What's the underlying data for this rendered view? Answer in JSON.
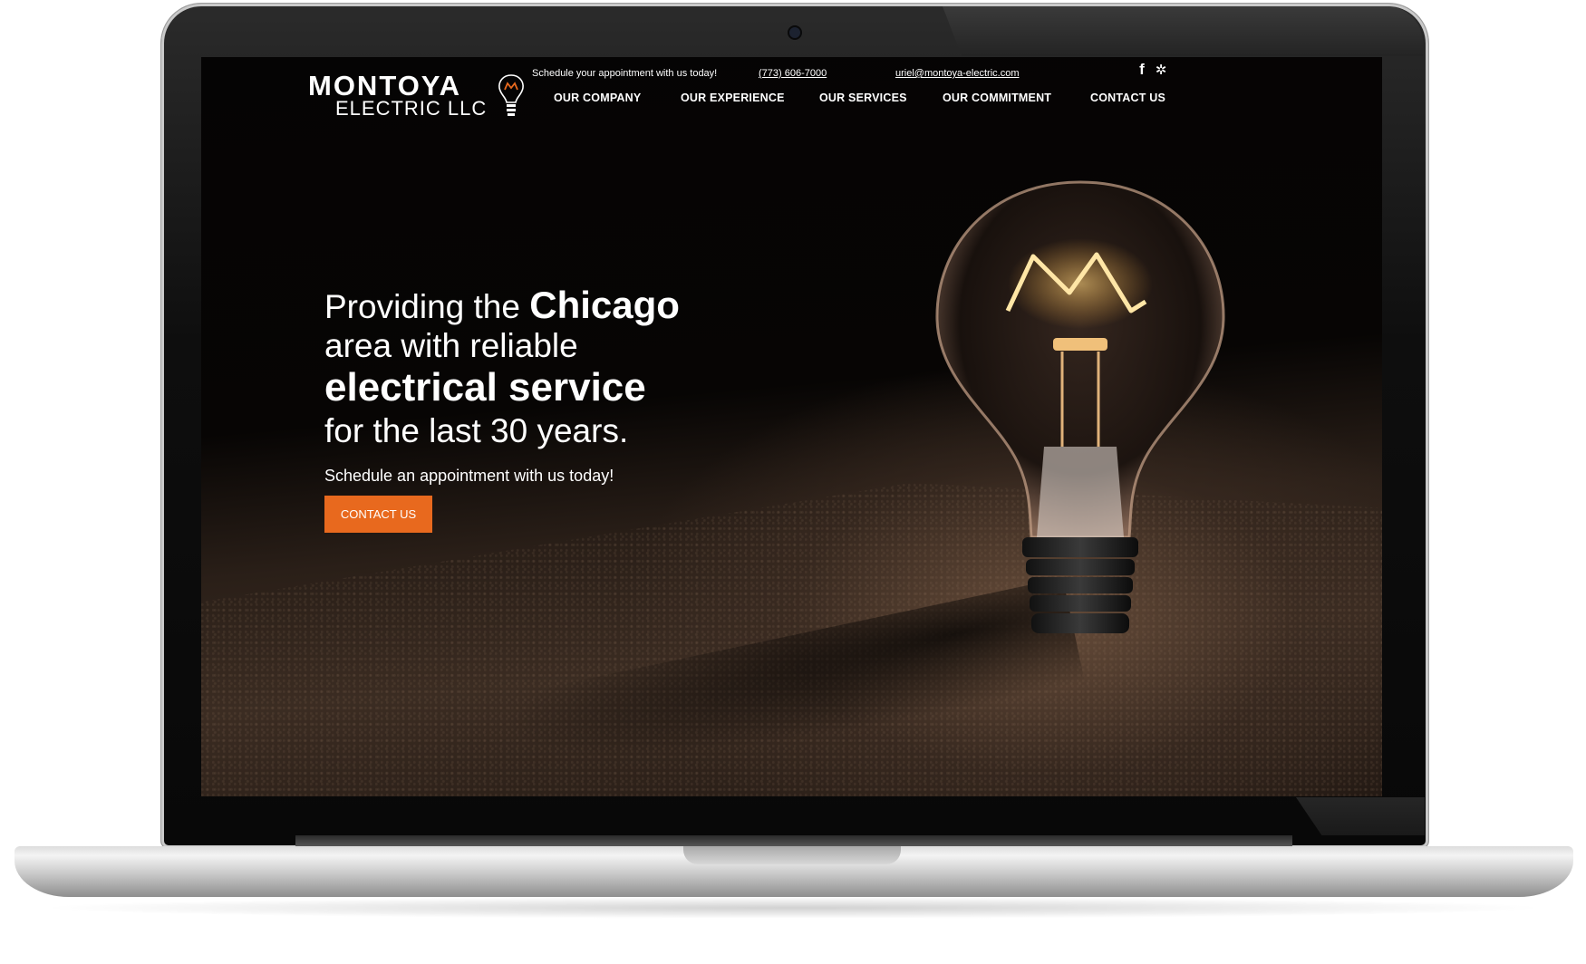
{
  "site": {
    "logo_line1": "MONTOYA",
    "logo_line2": "ELECTRIC LLC"
  },
  "topbar": {
    "schedule_text": "Schedule your appointment with us today!",
    "phone": "(773) 606-7000",
    "email": "uriel@montoya-electric.com",
    "social": [
      {
        "icon": "facebook-icon",
        "glyph": "f"
      },
      {
        "icon": "yelp-icon",
        "glyph": "✲"
      }
    ]
  },
  "nav": {
    "items": [
      "OUR COMPANY",
      "OUR EXPERIENCE",
      "OUR SERVICES",
      "OUR COMMITMENT",
      "CONTACT US"
    ]
  },
  "hero": {
    "line1_prefix": "Providing the ",
    "line1_bold": "Chicago",
    "line2": "area with reliable",
    "line3": "electrical service",
    "line4": "for the last 30 years.",
    "subtitle": "Schedule an appointment with us today!",
    "cta_label": "CONTACT US"
  },
  "colors": {
    "accent": "#e8691e",
    "background": "#050404",
    "text": "#ffffff"
  }
}
